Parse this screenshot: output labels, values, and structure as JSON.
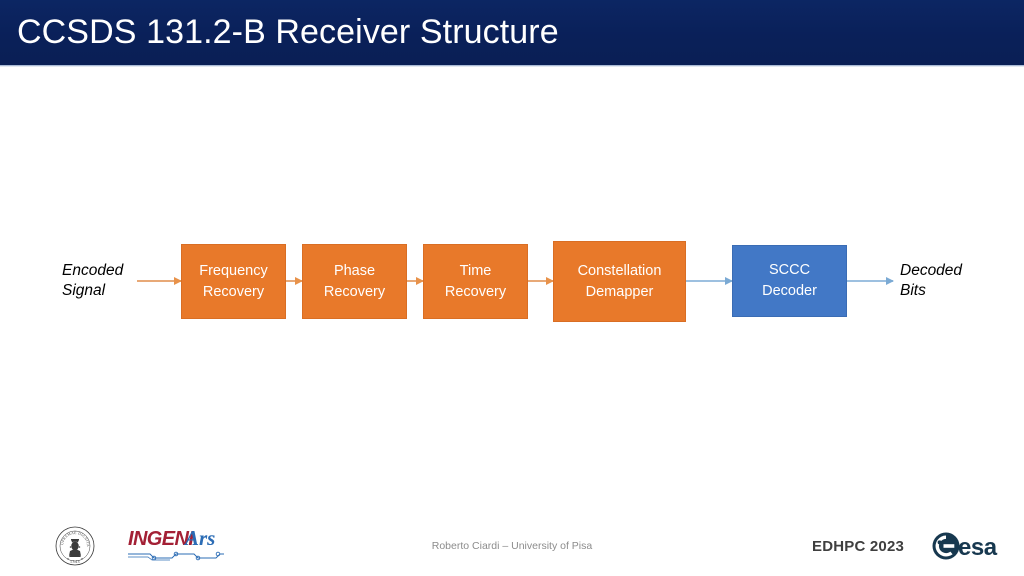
{
  "slide": {
    "title": "CCSDS 131.2-B Receiver Structure",
    "title_bar_color": "#0A2059",
    "background_color": "#FFFFFF"
  },
  "diagram": {
    "input_label": "Encoded\nSignal",
    "output_label": "Decoded\nBits",
    "orange_color": "#E8792A",
    "blue_color": "#4278C6",
    "orange_arrow_color": "#E8A977",
    "blue_arrow_color": "#9DC0E0",
    "blocks": [
      {
        "line1": "Frequency",
        "line2": "Recovery"
      },
      {
        "line1": "Phase",
        "line2": "Recovery"
      },
      {
        "line1": "Time",
        "line2": "Recovery"
      },
      {
        "line1": "Constellation",
        "line2": "Demapper"
      },
      {
        "line1": "SCCC",
        "line2": "Decoder"
      }
    ]
  },
  "footer": {
    "credit": "Roberto Ciardi – University of Pisa",
    "conference": "EDHPC 2023",
    "logos": {
      "university": "University of Pisa",
      "university_motto": "IN SUPREMAE DIGNITATIS",
      "university_year": "1343",
      "company_primary": "INGENI",
      "company_secondary": "Ars",
      "agency": "esa"
    }
  }
}
